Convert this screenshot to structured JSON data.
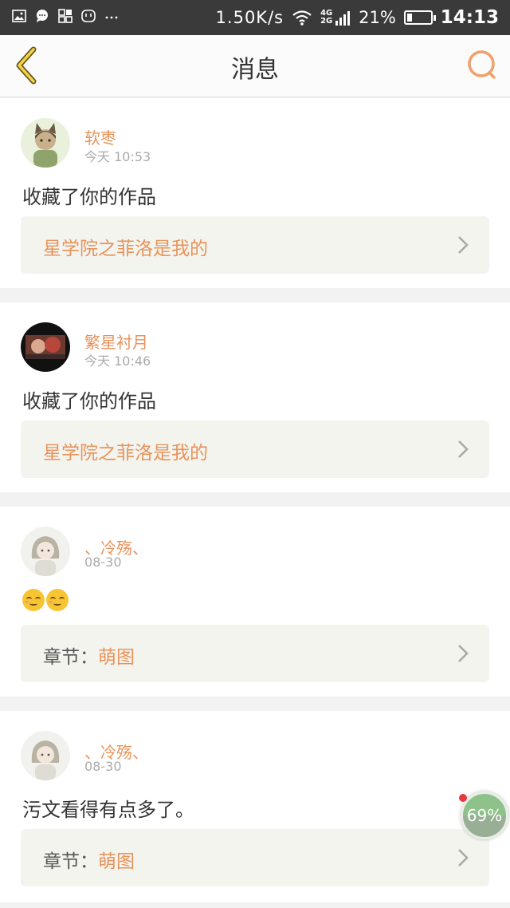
{
  "status_bar": {
    "net_speed": "1.50K/s",
    "network": "4G 2G",
    "battery_percent": "21%",
    "battery_level": 0.21,
    "time": "14:13",
    "left_icons": [
      "image-icon",
      "chat-icon",
      "grid-icon",
      "face-icon",
      "more-dots-icon"
    ]
  },
  "header": {
    "title": "消息",
    "accent_color": "#e8935a"
  },
  "messages": [
    {
      "user": "软枣",
      "time": "今天 10:53",
      "text": "收藏了你的作品",
      "ref_prefix": "",
      "ref_title": "星学院之菲洛是我的"
    },
    {
      "user": "繁星衬月",
      "time": "今天 10:46",
      "text": "收藏了你的作品",
      "ref_prefix": "",
      "ref_title": "星学院之菲洛是我的"
    },
    {
      "user": "、冷殇、",
      "time": "08-30",
      "text": "",
      "emoji": [
        "smile-emoji",
        "smile-emoji"
      ],
      "ref_prefix": "章节：",
      "ref_title": "萌图"
    },
    {
      "user": "、冷殇、",
      "time": "08-30",
      "text": "污文看得有点多了。",
      "ref_prefix": "章节：",
      "ref_title": "萌图"
    }
  ],
  "float_widget": {
    "label": "69%"
  }
}
